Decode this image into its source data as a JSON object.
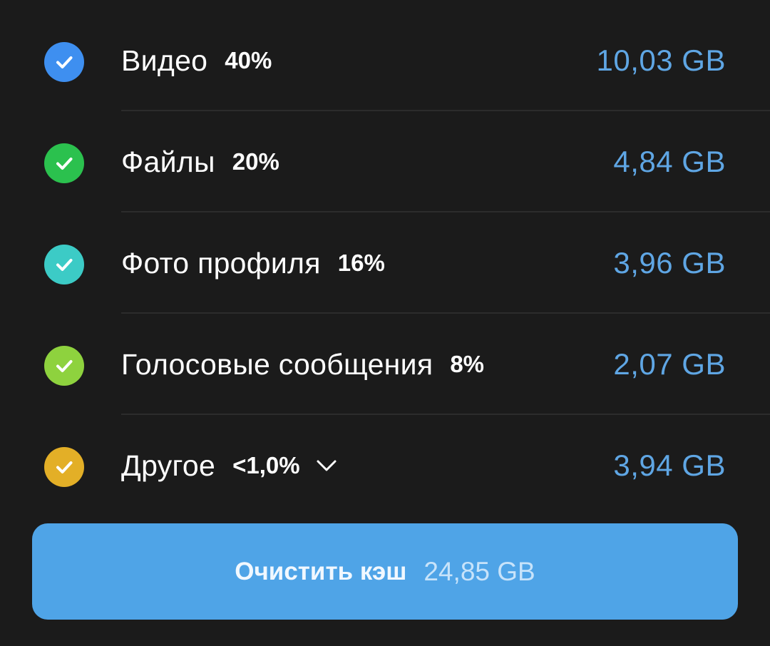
{
  "items": [
    {
      "name": "Видео",
      "percent": "40%",
      "size": "10,03 GB",
      "color": "#3e8ff0",
      "checked": true,
      "icon": "check-icon"
    },
    {
      "name": "Файлы",
      "percent": "20%",
      "size": "4,84 GB",
      "color": "#2bc14e",
      "checked": true,
      "icon": "check-icon"
    },
    {
      "name": "Фото профиля",
      "percent": "16%",
      "size": "3,96 GB",
      "color": "#3ccbc6",
      "checked": true,
      "icon": "check-icon"
    },
    {
      "name": "Голосовые сообщения",
      "percent": "8%",
      "size": "2,07 GB",
      "color": "#8ed23e",
      "checked": true,
      "icon": "check-icon"
    },
    {
      "name": "Другое",
      "percent": "<1,0%",
      "size": "3,94 GB",
      "color": "#e3af27",
      "checked": true,
      "icon": "check-icon",
      "expand_icon": "chevron-down-icon"
    }
  ],
  "clear_button": {
    "label": "Очистить кэш",
    "size": "24,85 GB",
    "color": "#4fa4e7"
  }
}
